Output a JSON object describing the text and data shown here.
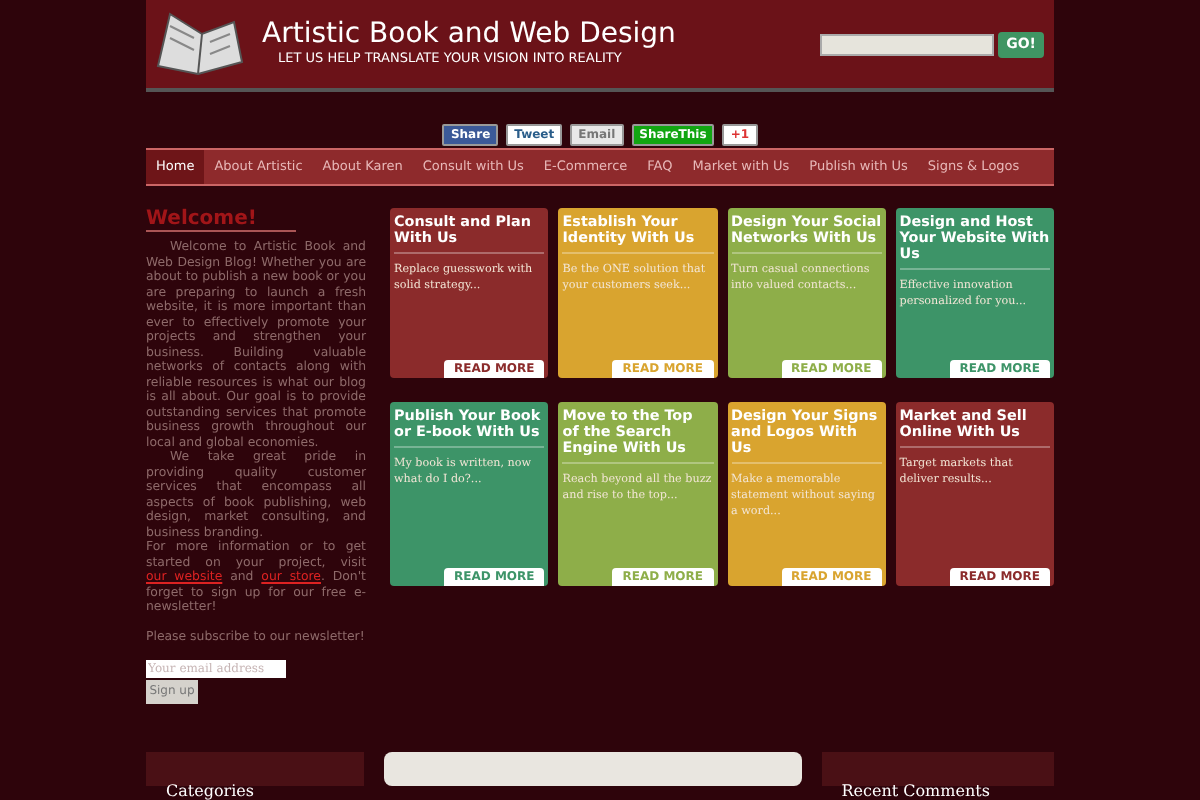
{
  "header": {
    "title": "Artistic Book and Web Design",
    "tagline": "LET US HELP TRANSLATE YOUR VISION INTO REALITY",
    "search_button": "GO!"
  },
  "share": [
    {
      "kind": "facebook",
      "label": "Share"
    },
    {
      "kind": "twitter",
      "label": "Tweet"
    },
    {
      "kind": "email",
      "label": "Email"
    },
    {
      "kind": "sharethis",
      "label": "ShareThis"
    },
    {
      "kind": "gplus",
      "label": "+1"
    }
  ],
  "nav": [
    {
      "label": "Home",
      "selected": true
    },
    {
      "label": "About Artistic",
      "selected": false
    },
    {
      "label": "About Karen",
      "selected": false
    },
    {
      "label": "Consult with Us",
      "selected": false
    },
    {
      "label": "E-Commerce",
      "selected": false
    },
    {
      "label": "FAQ",
      "selected": false
    },
    {
      "label": "Market with Us",
      "selected": false
    },
    {
      "label": "Publish with Us",
      "selected": false
    },
    {
      "label": "Signs & Logos",
      "selected": false
    }
  ],
  "welcome": {
    "heading": "Welcome!",
    "paragraphs": [
      "Welcome to Artistic Book and Web Design Blog! Whether you are about to publish a new book or you are preparing to launch a fresh website, it is more important than ever to effectively promote your projects and strengthen your business. Building valuable networks of contacts along with reliable resources is what our blog is all about. Our goal is to provide outstanding services that promote business growth throughout our local and global economies.",
      "We take great pride in providing quality customer services that encompass all aspects of book publishing, web design, market consulting, and business branding."
    ],
    "contact": {
      "before": "For more information or to get started on your project, visit ",
      "link_1": "our website",
      "middle": " and ",
      "link_2": "our store",
      "after": ". Don't forget to sign up for our free e-newsletter!"
    },
    "subscribe": "Please subscribe to our newsletter!",
    "email_placeholder": "Your email address",
    "signup_button": "Sign up"
  },
  "cards": [
    {
      "title": "Consult and Plan With Us",
      "text": "Replace guesswork with solid strategy...",
      "button": "READ MORE",
      "color": "#8b2b2b"
    },
    {
      "title": "Establish Your Identity With Us",
      "text": "Be the ONE solution that your customers seek...",
      "button": "READ MORE",
      "color": "#d9a42f"
    },
    {
      "title": "Design Your Social Networks With Us",
      "text": "Turn casual connections into valued contacts...",
      "button": "READ MORE",
      "color": "#8eae49"
    },
    {
      "title": "Design and Host Your Website With Us",
      "text": "Effective innovation personalized for you...",
      "button": "READ MORE",
      "color": "#3d9468"
    },
    {
      "title": "Publish Your Book or E-book With Us",
      "text": "My book is written, now what do I do?...",
      "button": "READ MORE",
      "color": "#3d9468"
    },
    {
      "title": "Move to the Top of the Search Engine With Us",
      "text": "Reach beyond all the buzz and rise to the top...",
      "button": "READ MORE",
      "color": "#8eae49"
    },
    {
      "title": "Design Your Signs and Logos With Us",
      "text": "Make a memorable statement without saying a word...",
      "button": "READ MORE",
      "color": "#d9a42f"
    },
    {
      "title": "Market and Sell Online With Us",
      "text": "Target markets that deliver results...",
      "button": "READ MORE",
      "color": "#8b2b2b"
    }
  ],
  "footer_widgets": {
    "left": "Categories",
    "right": "Recent Comments"
  }
}
